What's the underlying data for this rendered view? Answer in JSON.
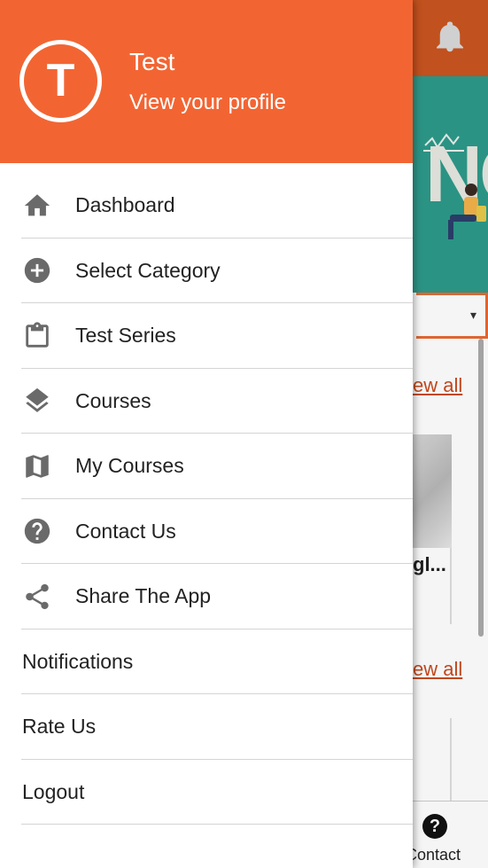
{
  "profile": {
    "initial": "T",
    "name": "Test",
    "subtitle": "View your profile"
  },
  "menu": {
    "items": [
      {
        "label": "Dashboard",
        "icon": "home-icon"
      },
      {
        "label": "Select Category",
        "icon": "plus-circle-icon"
      },
      {
        "label": "Test Series",
        "icon": "clipboard-icon"
      },
      {
        "label": "Courses",
        "icon": "layers-icon"
      },
      {
        "label": "My Courses",
        "icon": "map-icon"
      },
      {
        "label": "Contact Us",
        "icon": "help-circle-icon"
      },
      {
        "label": "Share The App",
        "icon": "share-icon"
      },
      {
        "label": "Notifications"
      },
      {
        "label": "Rate Us"
      },
      {
        "label": "Logout"
      }
    ]
  },
  "background": {
    "banner_text": "NG",
    "view_all_1": "ew all",
    "view_all_2": "ew all",
    "card_title": "gl...",
    "select_arrow": "▾",
    "bottom_nav_contact": "Contact"
  },
  "colors": {
    "header": "#f26533",
    "topbar_dimmed": "#c95520",
    "icon_gray": "#6a6a6a"
  }
}
